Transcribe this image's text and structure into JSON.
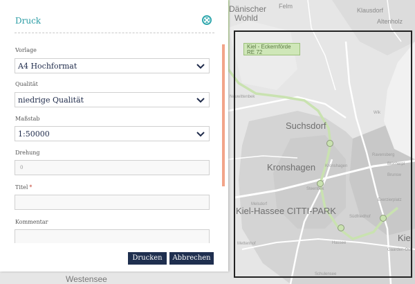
{
  "dialog": {
    "title": "Druck",
    "fields": {
      "template": {
        "label": "Vorlage",
        "value": "A4 Hochformat"
      },
      "quality": {
        "label": "Qualität",
        "value": "niedrige Qualität"
      },
      "scale": {
        "label": "Maßstab",
        "value": "1:50000"
      },
      "rotation": {
        "label": "Drehung",
        "value": "0"
      },
      "title": {
        "label": "Titel",
        "required_mark": "*",
        "value": ""
      },
      "comment": {
        "label": "Kommentar",
        "value": ""
      }
    },
    "buttons": {
      "print": "Drucken",
      "cancel": "Abbrechen"
    },
    "colors": {
      "title": "#2a9ca4",
      "button": "#1f2f4f",
      "scroll_thumb": "#f2a489"
    }
  },
  "map": {
    "route_label": "Kiel - Eckernförde RE 72",
    "labels": {
      "felm": "Felm",
      "daenischer": "Dänischer",
      "wohld": "Wohld",
      "klausdorf": "Klausdorf",
      "altenholz": "Altenholz",
      "suchsdorf": "Suchsdorf",
      "kronshagen": "Kronshagen",
      "kronshagen_small": "Kronshagen",
      "kiel_hassee": "Kiel-Hassee CITTI-PARK",
      "kiel_hb": "Kiel Hb",
      "westensee": "Westensee",
      "ravensberg": "Ravensberg",
      "bluecher": "Blücherpl",
      "brunsw": "Brunsw",
      "exerzierplatz": "Exerzierplatz",
      "suedfriedhof": "Südfriedhof",
      "hassee": "Hassee",
      "melsdorf": "Melsdorf",
      "neuwittenbek": "Neuwittenbek",
      "schulensee": "Schulensee",
      "mettenhof": "Mettenhof",
      "steenbek": "Steenbek",
      "gaarden": "Gaarden-Ost",
      "wik": "Wik"
    }
  }
}
